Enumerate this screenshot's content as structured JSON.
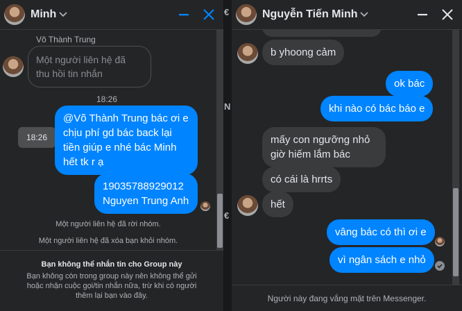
{
  "left_chat": {
    "header": {
      "name": "Minh"
    },
    "messages": {
      "sender_name": "Võ Thành Trung",
      "reply_preview": [
        "Một người liên hệ đã",
        "thu hồi tin nhắn"
      ],
      "timestamp": "18:26",
      "hover_time": "18:26",
      "outgoing_1": {
        "mention": "@Võ Thành Trung",
        "lines": [
          " bác ơi e",
          "chịu phí gd bác back lại",
          "tiền giúp e nhé bác Minh",
          "hết tk r ạ"
        ]
      },
      "outgoing_2": [
        "19035788929012",
        "Nguyen Trung Anh"
      ]
    },
    "system_messages": [
      "Một người liên hệ đã rời nhóm.",
      "Một người liên hệ đã xóa bạn khỏi nhóm."
    ],
    "footer": {
      "title": "Bạn không thể nhắn tin cho Group này",
      "description": "Bạn không còn trong group này nên không thể gửi hoặc nhận cuộc gọi/tin nhắn nữa, trừ khi có người thêm lại bạn vào đây."
    }
  },
  "right_chat": {
    "header": {
      "name": "Nguyễn Tiến Minh"
    },
    "messages": [
      {
        "dir": "in",
        "lines": [
          "b yhoong cảm"
        ]
      },
      {
        "dir": "out",
        "lines": [
          "ok bác"
        ]
      },
      {
        "dir": "out",
        "lines": [
          "khi nào có bác báo e"
        ]
      },
      {
        "dir": "in",
        "lines": [
          "mấy con ngưỡng nhỏ",
          "giờ hiếm lắm bác"
        ]
      },
      {
        "dir": "in",
        "lines": [
          "có cái là hrrts"
        ]
      },
      {
        "dir": "in",
        "lines": [
          "hết"
        ]
      },
      {
        "dir": "out",
        "lines": [
          "vâng bác có thì ơi e"
        ]
      },
      {
        "dir": "out",
        "lines": [
          "vì ngân sách e nhỏ"
        ]
      }
    ],
    "footer": {
      "status": "Người này đang vắng mặt trên Messenger."
    }
  },
  "behind_window_peek": [
    "€",
    "N",
    "€"
  ],
  "colors": {
    "background": "#18191a",
    "panel": "#242526",
    "incoming_bubble": "#3a3b3c",
    "outgoing_bubble": "#0084ff",
    "accent": "#0084ff"
  },
  "icons": {
    "header_dropdown": "chevron-down-icon",
    "minimize": "minimize-icon",
    "close": "close-icon",
    "sent": "check-circle-icon"
  }
}
